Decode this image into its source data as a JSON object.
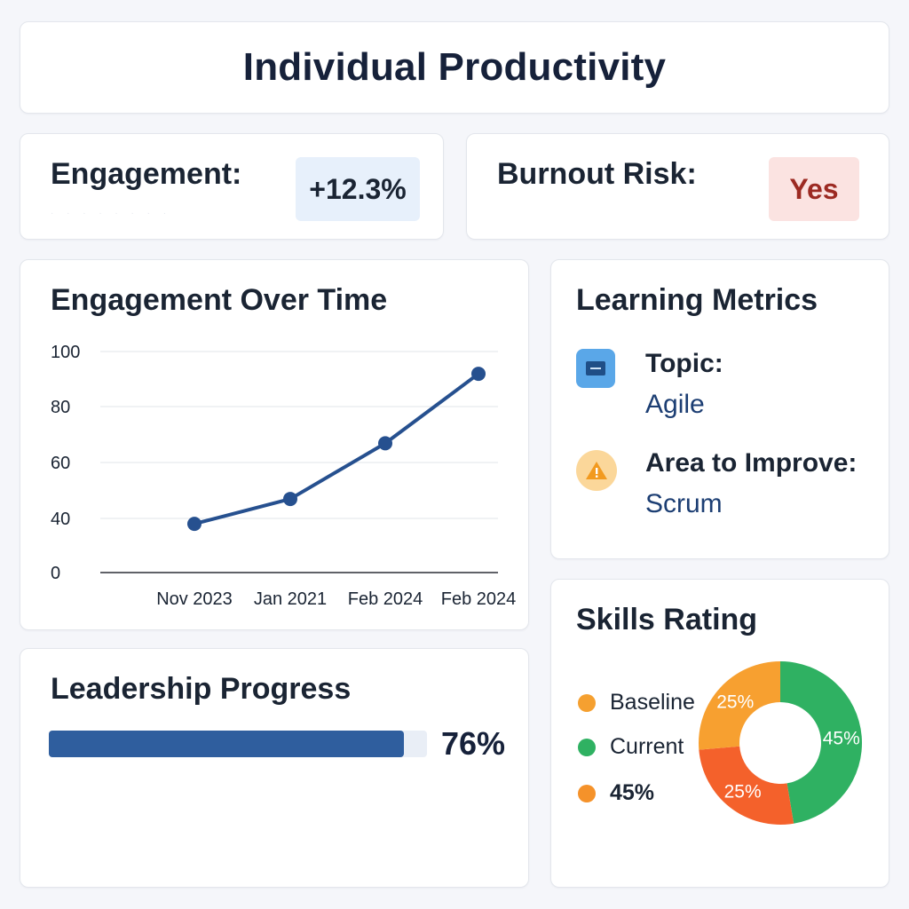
{
  "header": {
    "title": "Individual Productivity"
  },
  "kpis": {
    "engagement": {
      "label": "Engagement:",
      "value": "+12.3%",
      "dots": "· · · · · · · ·"
    },
    "burnout": {
      "label": "Burnout Risk:",
      "value": "Yes"
    }
  },
  "chart_data": {
    "type": "line",
    "title": "Engagement Over Time",
    "categories": [
      "Nov 2023",
      "Jan 2021",
      "Feb 2024",
      "Feb 2024"
    ],
    "values": [
      36,
      47,
      67,
      92
    ],
    "yticks": [
      0,
      40,
      60,
      80,
      100
    ],
    "ylim": [
      0,
      100
    ],
    "grid": true,
    "color": "#26508f"
  },
  "learning": {
    "title": "Learning Metrics",
    "topic_label": "Topic:",
    "topic_value": "Agile",
    "topic_icon": "document-icon",
    "improve_label": "Area to Improve:",
    "improve_value": "Scrum",
    "improve_icon": "warning-icon"
  },
  "leadership": {
    "title": "Leadership Progress",
    "progress": 0.76,
    "progress_label": "76%",
    "color": "#2f5e9e"
  },
  "skills": {
    "title": "Skills Rating",
    "legend": [
      {
        "label": "Baseline",
        "color": "#f5a030"
      },
      {
        "label": "Current",
        "color": "#2fb162"
      },
      {
        "label": "45%",
        "color": "#f5922a"
      }
    ],
    "chart_data": {
      "type": "pie",
      "donut": true,
      "slices": [
        {
          "label": "45%",
          "value": 45,
          "color": "#2fb162"
        },
        {
          "label": "25%",
          "value": 25,
          "color": "#f4612b"
        },
        {
          "label": "25%",
          "value": 25,
          "color": "#f7a030"
        }
      ]
    }
  }
}
